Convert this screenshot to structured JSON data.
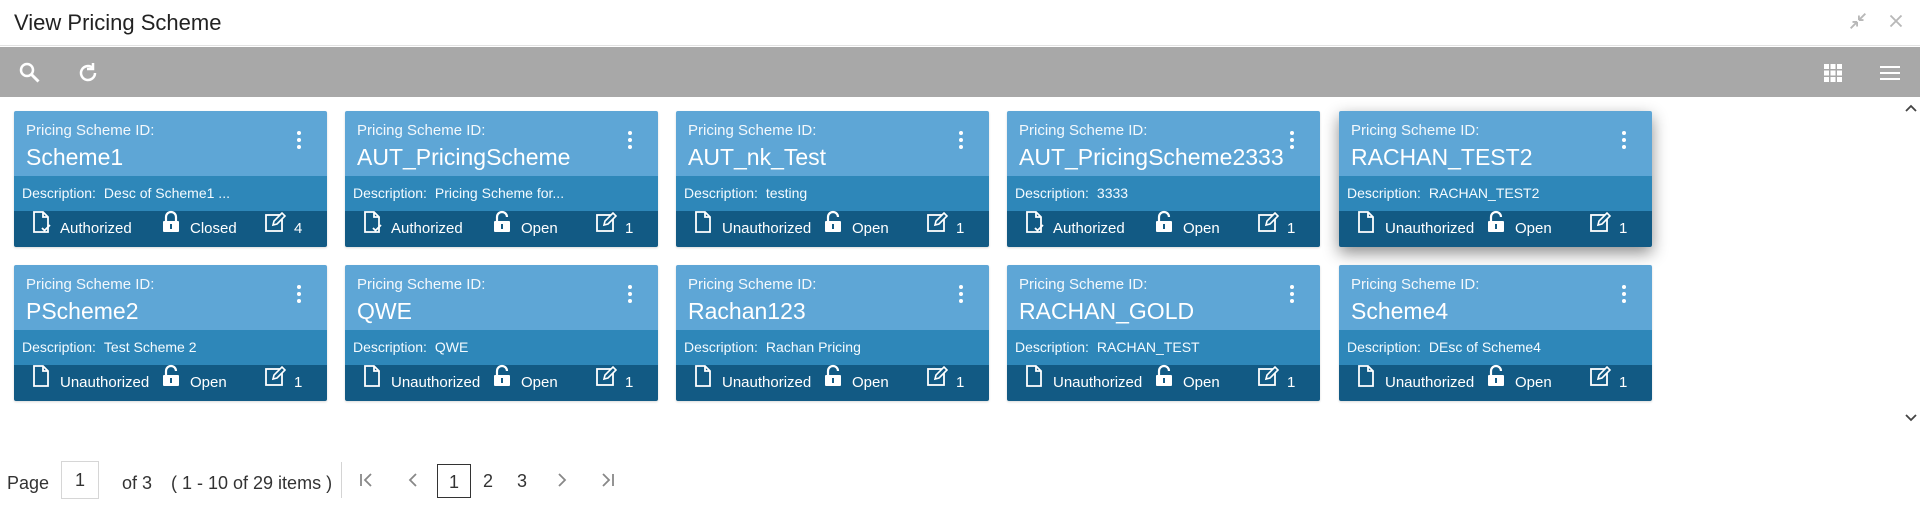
{
  "window": {
    "title": "View Pricing Scheme"
  },
  "icons": {
    "minimize": "compress-icon",
    "close": "close-icon",
    "search": "search-icon",
    "refresh": "refresh-icon",
    "grid": "grid-view-icon",
    "list": "list-view-icon",
    "kebab": "kebab-menu-icon",
    "authorization": "document-icon",
    "lock": "lock-icon",
    "edit": "edit-icon"
  },
  "colors": {
    "toolbar": "#a8a8a8",
    "card_top": "#5ea6d6",
    "card_desc": "#2e87b9",
    "card_stats": "#125a84"
  },
  "card_labels": {
    "id_label": "Pricing Scheme ID:",
    "desc_label": "Description:"
  },
  "cards": [
    {
      "id": "Scheme1",
      "description": "Desc of Scheme1 ...",
      "auth_status": "Authorized",
      "record_status": "Closed",
      "mod_count": "4"
    },
    {
      "id": "AUT_PricingScheme",
      "description": "Pricing Scheme for...",
      "auth_status": "Authorized",
      "record_status": "Open",
      "mod_count": "1"
    },
    {
      "id": "AUT_nk_Test",
      "description": "testing",
      "auth_status": "Unauthorized",
      "record_status": "Open",
      "mod_count": "1"
    },
    {
      "id": "AUT_PricingScheme2333",
      "description": "3333",
      "auth_status": "Authorized",
      "record_status": "Open",
      "mod_count": "1"
    },
    {
      "id": "RACHAN_TEST2",
      "description": "RACHAN_TEST2",
      "auth_status": "Unauthorized",
      "record_status": "Open",
      "mod_count": "1"
    },
    {
      "id": "PScheme2",
      "description": "Test Scheme 2",
      "auth_status": "Unauthorized",
      "record_status": "Open",
      "mod_count": "1"
    },
    {
      "id": "QWE",
      "description": "QWE",
      "auth_status": "Unauthorized",
      "record_status": "Open",
      "mod_count": "1"
    },
    {
      "id": "Rachan123",
      "description": "Rachan Pricing",
      "auth_status": "Unauthorized",
      "record_status": "Open",
      "mod_count": "1"
    },
    {
      "id": "RACHAN_GOLD",
      "description": "RACHAN_TEST",
      "auth_status": "Unauthorized",
      "record_status": "Open",
      "mod_count": "1"
    },
    {
      "id": "Scheme4",
      "description": "DEsc of Scheme4",
      "auth_status": "Unauthorized",
      "record_status": "Open",
      "mod_count": "1"
    }
  ],
  "pagination": {
    "page_label": "Page",
    "current_page": "1",
    "of_label": "of 3",
    "range_text": "( 1 - 10 of 29 items )",
    "pages": [
      "1",
      "2",
      "3"
    ]
  }
}
